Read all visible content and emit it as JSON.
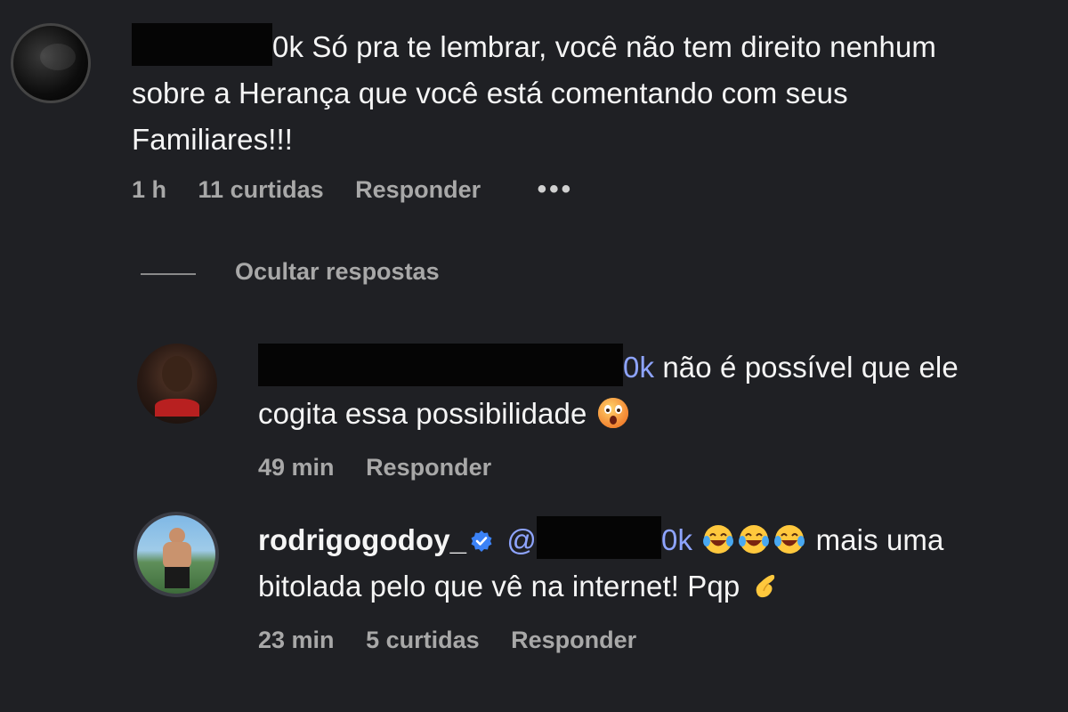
{
  "comments": [
    {
      "user_suffix": "0k",
      "text": "Só pra te lembrar, você não tem direito nenhum sobre a Herança que você está comentando com seus Familiares!!!",
      "line1": "Só pra te lembrar, você não tem direito nenhum",
      "line2": "sobre a Herança que você está comentando com seus",
      "line3": "Familiares!!!",
      "time": "1 h",
      "likes": "11 curtidas",
      "reply_label": "Responder",
      "more": "•••"
    }
  ],
  "hide_replies_label": "Ocultar respostas",
  "replies": [
    {
      "mention_suffix": "0k",
      "line1": "não é possível que ele",
      "line2": "cogita essa possibilidade",
      "emoji": "astonished-face",
      "time": "49 min",
      "reply_label": "Responder"
    },
    {
      "username": "rodrigogodoy_",
      "verified": true,
      "mention_prefix": "@",
      "mention_suffix": "0k",
      "emojis": [
        "laughing-tears-face",
        "laughing-tears-face",
        "laughing-tears-face"
      ],
      "line1_tail": "mais uma",
      "line2": "bitolada pelo que vê na internet! Pqp",
      "emoji_end": "pinching-hand",
      "time": "23 min",
      "likes": "5 curtidas",
      "reply_label": "Responder"
    }
  ],
  "colors": {
    "background": "#1f2024",
    "text": "#f5f5f5",
    "meta": "#a8a8a8",
    "mention": "#8ea4ff",
    "verified": "#3b82f6"
  }
}
